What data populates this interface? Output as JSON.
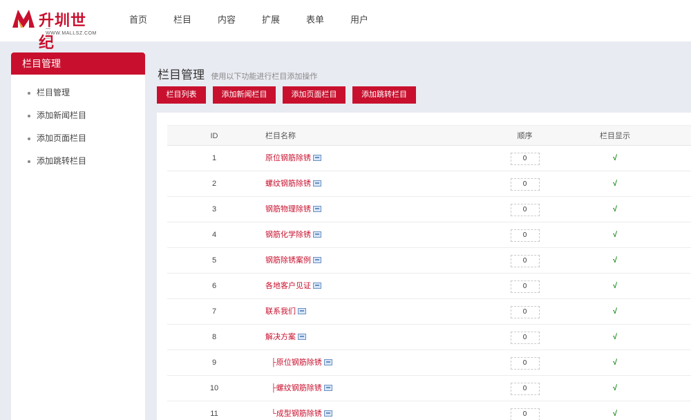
{
  "logo": {
    "text": "升圳世纪",
    "sub": "— WWW.MALLSZ.COM —"
  },
  "nav": [
    "首页",
    "栏目",
    "内容",
    "扩展",
    "表单",
    "用户"
  ],
  "sidebar": {
    "title": "栏目管理",
    "items": [
      "栏目管理",
      "添加新闻栏目",
      "添加页面栏目",
      "添加跳转栏目"
    ]
  },
  "main": {
    "title": "栏目管理",
    "desc": "使用以下功能进行栏目添加操作",
    "buttons": [
      "栏目列表",
      "添加新闻栏目",
      "添加页面栏目",
      "添加跳转栏目"
    ]
  },
  "table": {
    "headers": [
      "ID",
      "栏目名称",
      "顺序",
      "栏目显示"
    ],
    "rows": [
      {
        "id": "1",
        "name": "原位钢筋除锈",
        "order": "0",
        "show": "√",
        "child": false
      },
      {
        "id": "2",
        "name": "螺纹钢筋除锈",
        "order": "0",
        "show": "√",
        "child": false
      },
      {
        "id": "3",
        "name": "钢筋物理除锈",
        "order": "0",
        "show": "√",
        "child": false
      },
      {
        "id": "4",
        "name": "钢筋化学除锈",
        "order": "0",
        "show": "√",
        "child": false
      },
      {
        "id": "5",
        "name": "钢筋除锈案例",
        "order": "0",
        "show": "√",
        "child": false
      },
      {
        "id": "6",
        "name": "各地客户见证",
        "order": "0",
        "show": "√",
        "child": false
      },
      {
        "id": "7",
        "name": "联系我们",
        "order": "0",
        "show": "√",
        "child": false
      },
      {
        "id": "8",
        "name": "解决方案",
        "order": "0",
        "show": "√",
        "child": false
      },
      {
        "id": "9",
        "name": "原位钢筋除锈",
        "order": "0",
        "show": "√",
        "child": true,
        "prefix": "├"
      },
      {
        "id": "10",
        "name": "螺纹钢筋除锈",
        "order": "0",
        "show": "√",
        "child": true,
        "prefix": "├"
      },
      {
        "id": "11",
        "name": "成型钢筋除锈",
        "order": "0",
        "show": "√",
        "child": true,
        "prefix": "└"
      }
    ]
  },
  "colors": {
    "brand": "#c8102e",
    "check": "#1a8a1a"
  },
  "icons": {
    "edit": "edit-icon"
  }
}
